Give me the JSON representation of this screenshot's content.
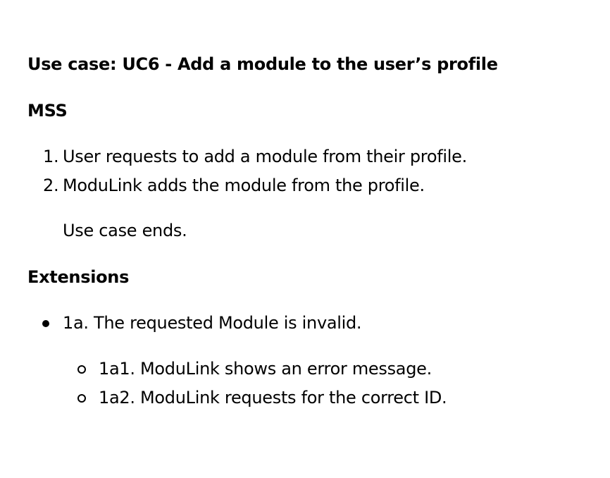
{
  "use_case": {
    "title": "Use case: UC6 - Add a module to the user’s profile",
    "mss_heading": "MSS",
    "steps": [
      {
        "number": "1.",
        "text": "User requests to add a module from their profile."
      },
      {
        "number": "2.",
        "text": "ModuLink adds the module from the profile."
      }
    ],
    "ends_text": "Use case ends.",
    "extensions_heading": "Extensions",
    "extensions": [
      {
        "text": "1a. The requested Module is invalid.",
        "sub_items": [
          "1a1. ModuLink shows an error message.",
          "1a2. ModuLink requests for the correct ID."
        ]
      }
    ]
  }
}
